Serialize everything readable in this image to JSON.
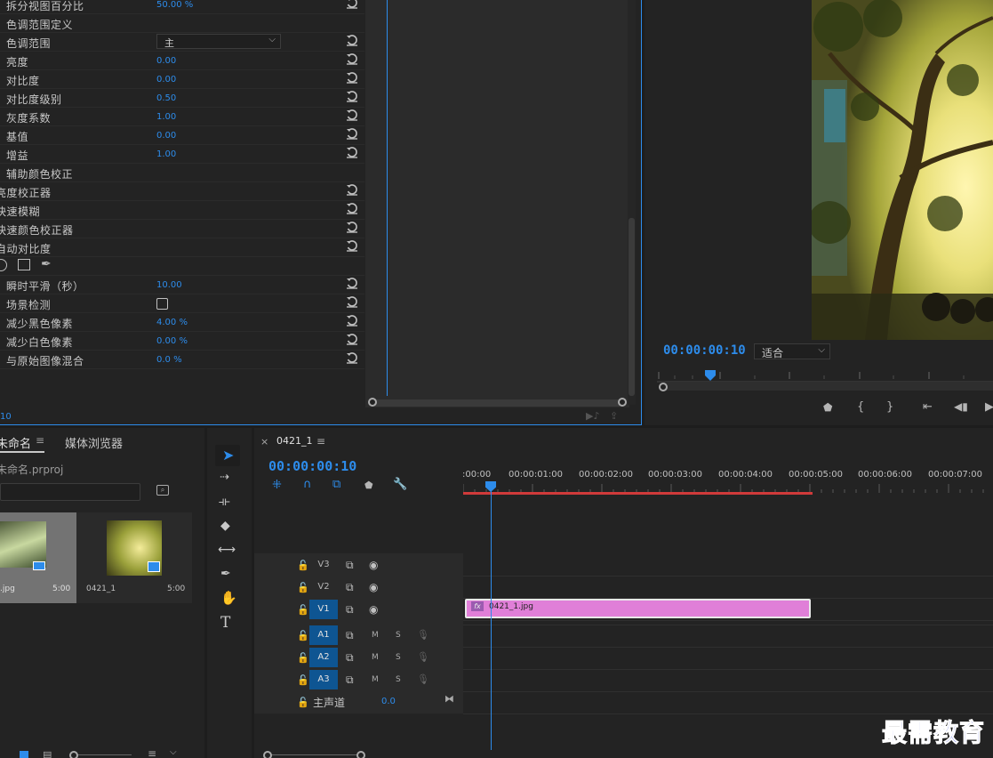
{
  "effect_controls": {
    "rows": [
      {
        "label": "拆分视图百分比",
        "value": "50.00 %",
        "reset": true
      },
      {
        "label": "色调范围定义",
        "value": "",
        "reset": false
      },
      {
        "label": "色调范围",
        "value": "",
        "reset": true
      },
      {
        "label": "亮度",
        "value": "0.00",
        "reset": true
      },
      {
        "label": "对比度",
        "value": "0.00",
        "reset": true
      },
      {
        "label": "对比度级别",
        "value": "0.50",
        "reset": true
      },
      {
        "label": "灰度系数",
        "value": "1.00",
        "reset": true
      },
      {
        "label": "基值",
        "value": "0.00",
        "reset": true
      },
      {
        "label": "增益",
        "value": "1.00",
        "reset": true
      },
      {
        "label": "辅助颜色校正",
        "value": "",
        "reset": false
      },
      {
        "label": "亮度校正器",
        "value": "",
        "reset": true
      },
      {
        "label": "快速模糊",
        "value": "",
        "reset": true
      },
      {
        "label": "快速颜色校正器",
        "value": "",
        "reset": true
      },
      {
        "label": "自动对比度",
        "value": "",
        "reset": true
      },
      {
        "label": "",
        "value": "",
        "reset": false
      },
      {
        "label": "瞬时平滑（秒）",
        "value": "10.00",
        "reset": true
      },
      {
        "label": "场景检测",
        "value": "",
        "reset": true
      },
      {
        "label": "减少黑色像素",
        "value": "4.00 %",
        "reset": true
      },
      {
        "label": "减少白色像素",
        "value": "0.00 %",
        "reset": true
      },
      {
        "label": "与原始图像混合",
        "value": "0.0 %",
        "reset": true
      }
    ],
    "tonal_range_selected": "主",
    "timecode": "10"
  },
  "program_monitor": {
    "timecode": "00:00:00:10",
    "fit_label": "适合"
  },
  "project_panel": {
    "tab_project": "未命名",
    "tab_media_browser": "媒体浏览器",
    "project_file": "未命名.prproj",
    "items": [
      {
        "name": ".jpg",
        "duration": "5:00"
      },
      {
        "name": "0421_1",
        "duration": "5:00"
      }
    ]
  },
  "timeline": {
    "sequence_tab": "0421_1",
    "timecode": "00:00:00:10",
    "ruler_labels": [
      ":00:00",
      "00:00:01:00",
      "00:00:02:00",
      "00:00:03:00",
      "00:00:04:00",
      "00:00:05:00",
      "00:00:06:00",
      "00:00:07:00"
    ],
    "video_tracks": [
      "V3",
      "V2",
      "V1"
    ],
    "audio_tracks": [
      "A1",
      "A2",
      "A3"
    ],
    "track_m": "M",
    "track_s": "S",
    "master_label": "主声道",
    "master_value": "0.0",
    "clip_label": "0421_1.jpg",
    "fx_badge": "fx"
  },
  "watermark": "最需教育",
  "colors": {
    "accent": "#2d8ceb",
    "clip": "#e07fd8",
    "work_area": "#d03a3a",
    "track_active": "#0e5592"
  }
}
